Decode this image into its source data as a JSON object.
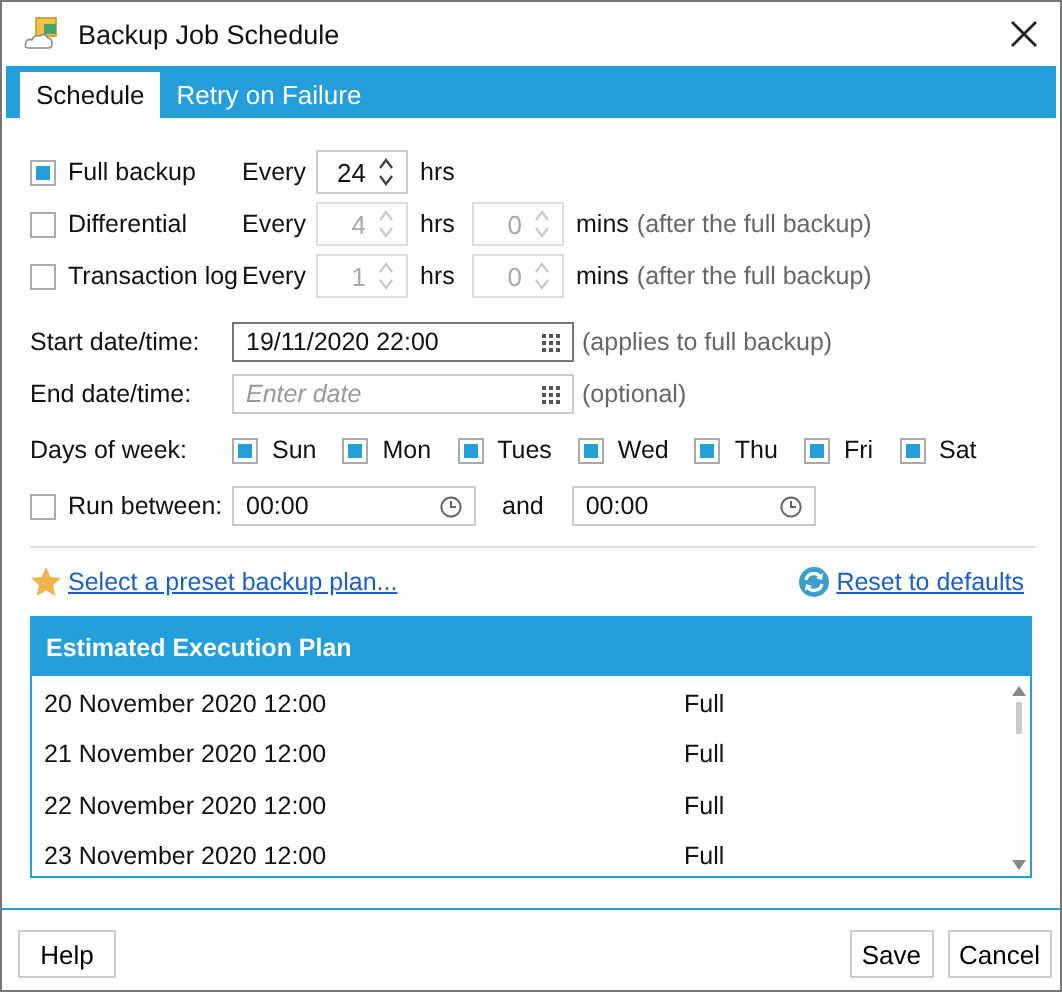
{
  "window": {
    "title": "Backup Job Schedule"
  },
  "tabs": [
    {
      "label": "Schedule",
      "selected": true
    },
    {
      "label": "Retry on Failure",
      "selected": false
    }
  ],
  "backups": [
    {
      "label": "Full backup",
      "checked": true,
      "every": "Every",
      "hours": "24",
      "hrs": "hrs",
      "disabled": false
    },
    {
      "label": "Differential",
      "checked": false,
      "every": "Every",
      "hours": "4",
      "hrs": "hrs",
      "minutes": "0",
      "mins": "mins",
      "note": "(after the full backup)",
      "disabled": true
    },
    {
      "label": "Transaction log",
      "checked": false,
      "every": "Every",
      "hours": "1",
      "hrs": "hrs",
      "minutes": "0",
      "mins": "mins",
      "note": "(after the full backup)",
      "disabled": true
    }
  ],
  "start": {
    "label": "Start date/time:",
    "value": "19/11/2020 22:00",
    "note": "(applies to full backup)"
  },
  "end": {
    "label": "End date/time:",
    "placeholder": "Enter date",
    "note": "(optional)"
  },
  "days": {
    "label": "Days of week:",
    "items": [
      {
        "label": "Sun",
        "checked": true
      },
      {
        "label": "Mon",
        "checked": true
      },
      {
        "label": "Tues",
        "checked": true
      },
      {
        "label": "Wed",
        "checked": true
      },
      {
        "label": "Thu",
        "checked": true
      },
      {
        "label": "Fri",
        "checked": true
      },
      {
        "label": "Sat",
        "checked": true
      }
    ]
  },
  "run_between": {
    "label": "Run between:",
    "checked": false,
    "from": "00:00",
    "and": "and",
    "to": "00:00"
  },
  "preset_link": "Select a preset backup plan...",
  "reset_link": "Reset to defaults",
  "plan": {
    "title": "Estimated Execution Plan",
    "rows": [
      {
        "date": "20 November 2020 12:00",
        "type": "Full"
      },
      {
        "date": "21 November 2020 12:00",
        "type": "Full"
      },
      {
        "date": "22 November 2020 12:00",
        "type": "Full"
      },
      {
        "date": "23 November 2020 12:00",
        "type": "Full"
      }
    ]
  },
  "buttons": {
    "help": "Help",
    "save": "Save",
    "cancel": "Cancel"
  }
}
